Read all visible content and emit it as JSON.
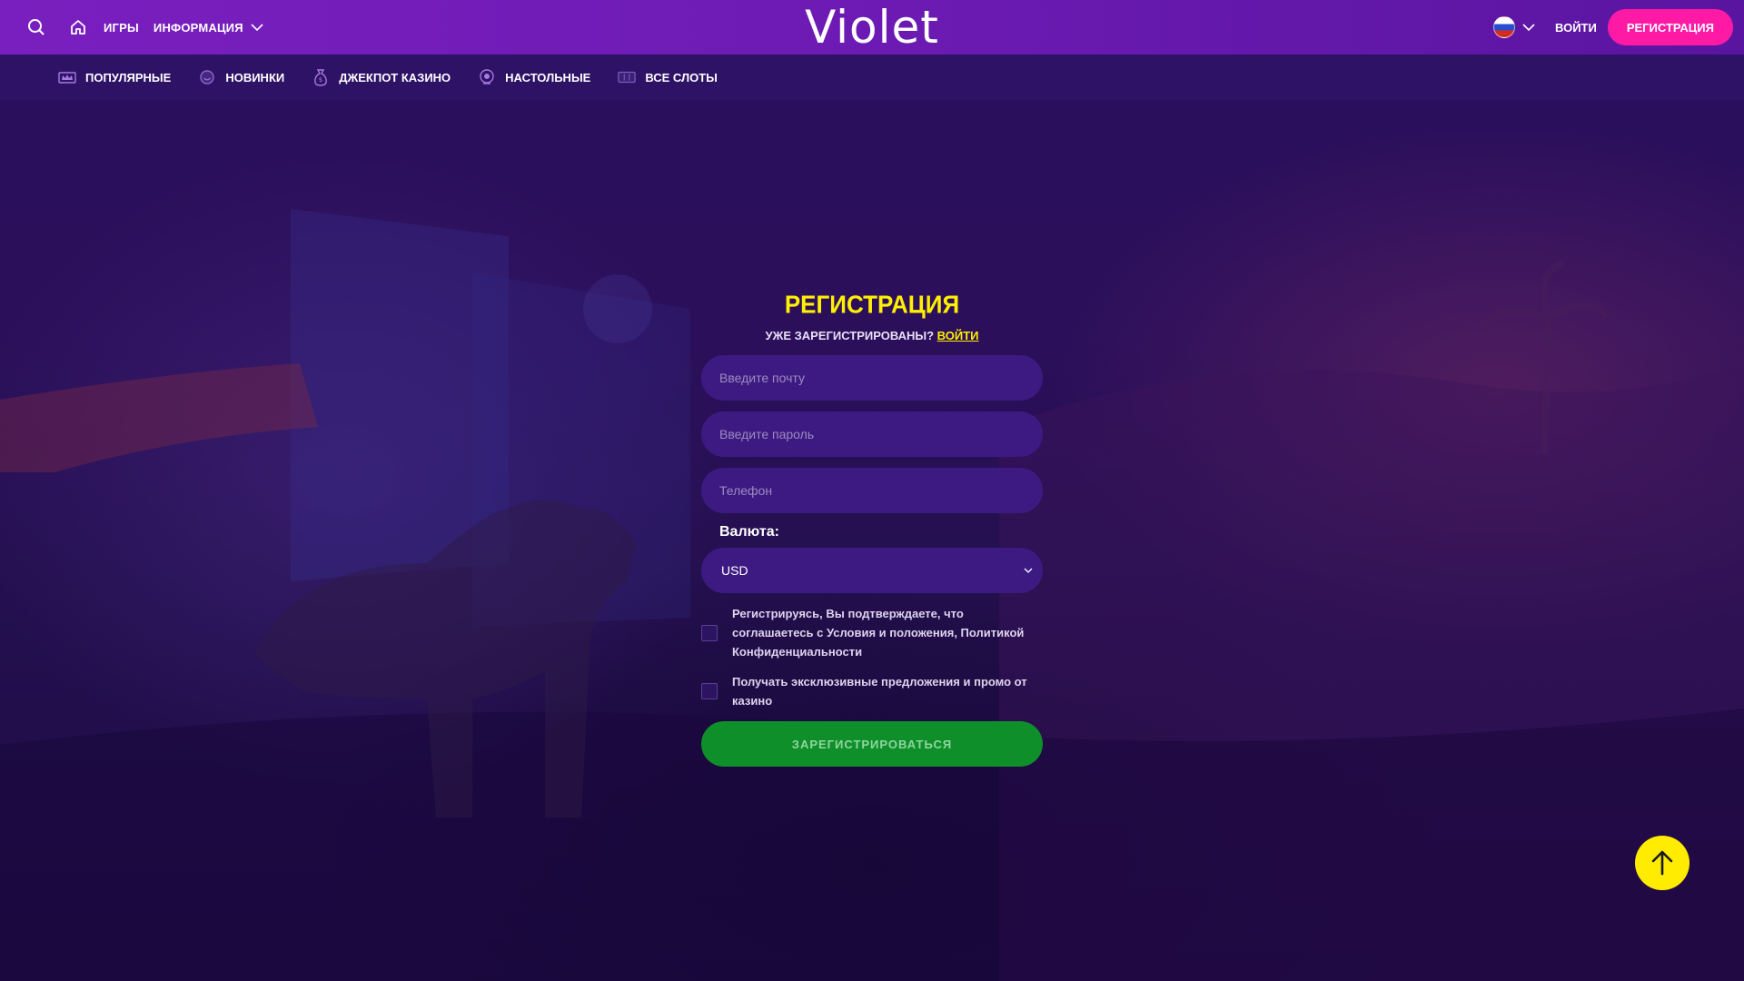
{
  "header": {
    "logo": "Violet",
    "nav": {
      "games": "ИГРЫ",
      "info": "ИНФОРМАЦИЯ"
    },
    "login": "ВОЙТИ",
    "register": "РЕГИСТРАЦИЯ",
    "language_flag": "russia-flag-icon"
  },
  "categories": [
    {
      "label": "ПОПУЛЯРНЫЕ",
      "icon": "crown-icon"
    },
    {
      "label": "НОВИНКИ",
      "icon": "smiley-icon"
    },
    {
      "label": "ДЖЕКПОТ КАЗИНО",
      "icon": "money-bag-icon"
    },
    {
      "label": "НАСТОЛЬНЫЕ",
      "icon": "roulette-icon"
    },
    {
      "label": "ВСЕ СЛОТЫ",
      "icon": "slot-machine-icon"
    }
  ],
  "form": {
    "title": "РЕГИСТРАЦИЯ",
    "already_registered": "УЖЕ ЗАРЕГИСТРИРОВАНЫ?",
    "login_link": "ВОЙТИ",
    "email_placeholder": "Введите почту",
    "password_placeholder": "Введите пароль",
    "phone_placeholder": "Телефон",
    "currency_label": "Валюта:",
    "currency_value": "USD",
    "terms_text": "Регистрируясь, Вы подтверждаете, что соглашаетесь с Условия и положения, Политикой Конфиденциальности",
    "promo_text": "Получать эксклюзивные предложения и промо от казино",
    "submit": "ЗАРЕГИСТРИРОВАТЬСЯ"
  },
  "colors": {
    "header": "#7a1fbf",
    "register_button": "#ff1aa6",
    "title": "#ffef00",
    "submit": "#0f8f2a",
    "scroll_top": "#ffec00"
  }
}
